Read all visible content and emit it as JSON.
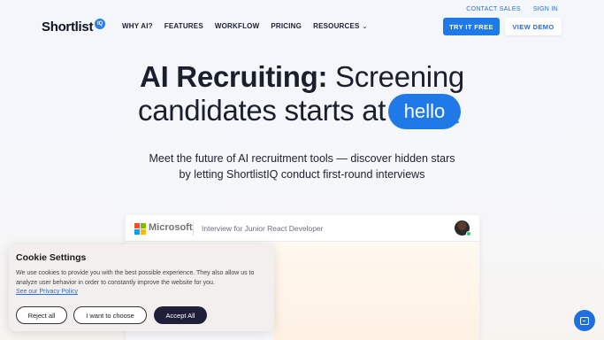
{
  "header": {
    "logo_text": "Shortlist",
    "logo_badge": "IQ",
    "nav": [
      {
        "label": "WHY AI?"
      },
      {
        "label": "FEATURES"
      },
      {
        "label": "WORKFLOW"
      },
      {
        "label": "PRICING"
      },
      {
        "label": "RESOURCES",
        "has_dropdown": true
      }
    ],
    "contact_sales": "CONTACT SALES",
    "sign_in": "SIGN IN",
    "try_it_free": "TRY IT FREE",
    "view_demo": "VIEW DEMO"
  },
  "hero": {
    "title_bold": "AI Recruiting:",
    "title_rest": "Screening",
    "line2": "candidates starts at",
    "bubble_text": "hello",
    "subtitle_line1": "Meet the future of AI recruitment tools — discover hidden stars",
    "subtitle_line2": "by letting ShortlistIQ conduct first-round interviews"
  },
  "preview": {
    "company": "Microsoft",
    "interview_title": "Interview for Junior React Developer"
  },
  "cookie": {
    "title": "Cookie Settings",
    "text": "We use cookies to provide you with the best possible experience. They also allow us to analyze user behavior in order to constantly improve the website for you.",
    "privacy_link": "See our Privacy Policy",
    "reject": "Reject all",
    "choose": "I want to choose",
    "accept": "Accept All"
  },
  "colors": {
    "accent": "#1f7ae8",
    "dark_button": "#1f1f3a",
    "link": "#2a6cd8"
  },
  "icons": {
    "chat": "chat-icon",
    "chevron": "chevron-down-icon",
    "microsoft": "microsoft-logo-icon"
  }
}
